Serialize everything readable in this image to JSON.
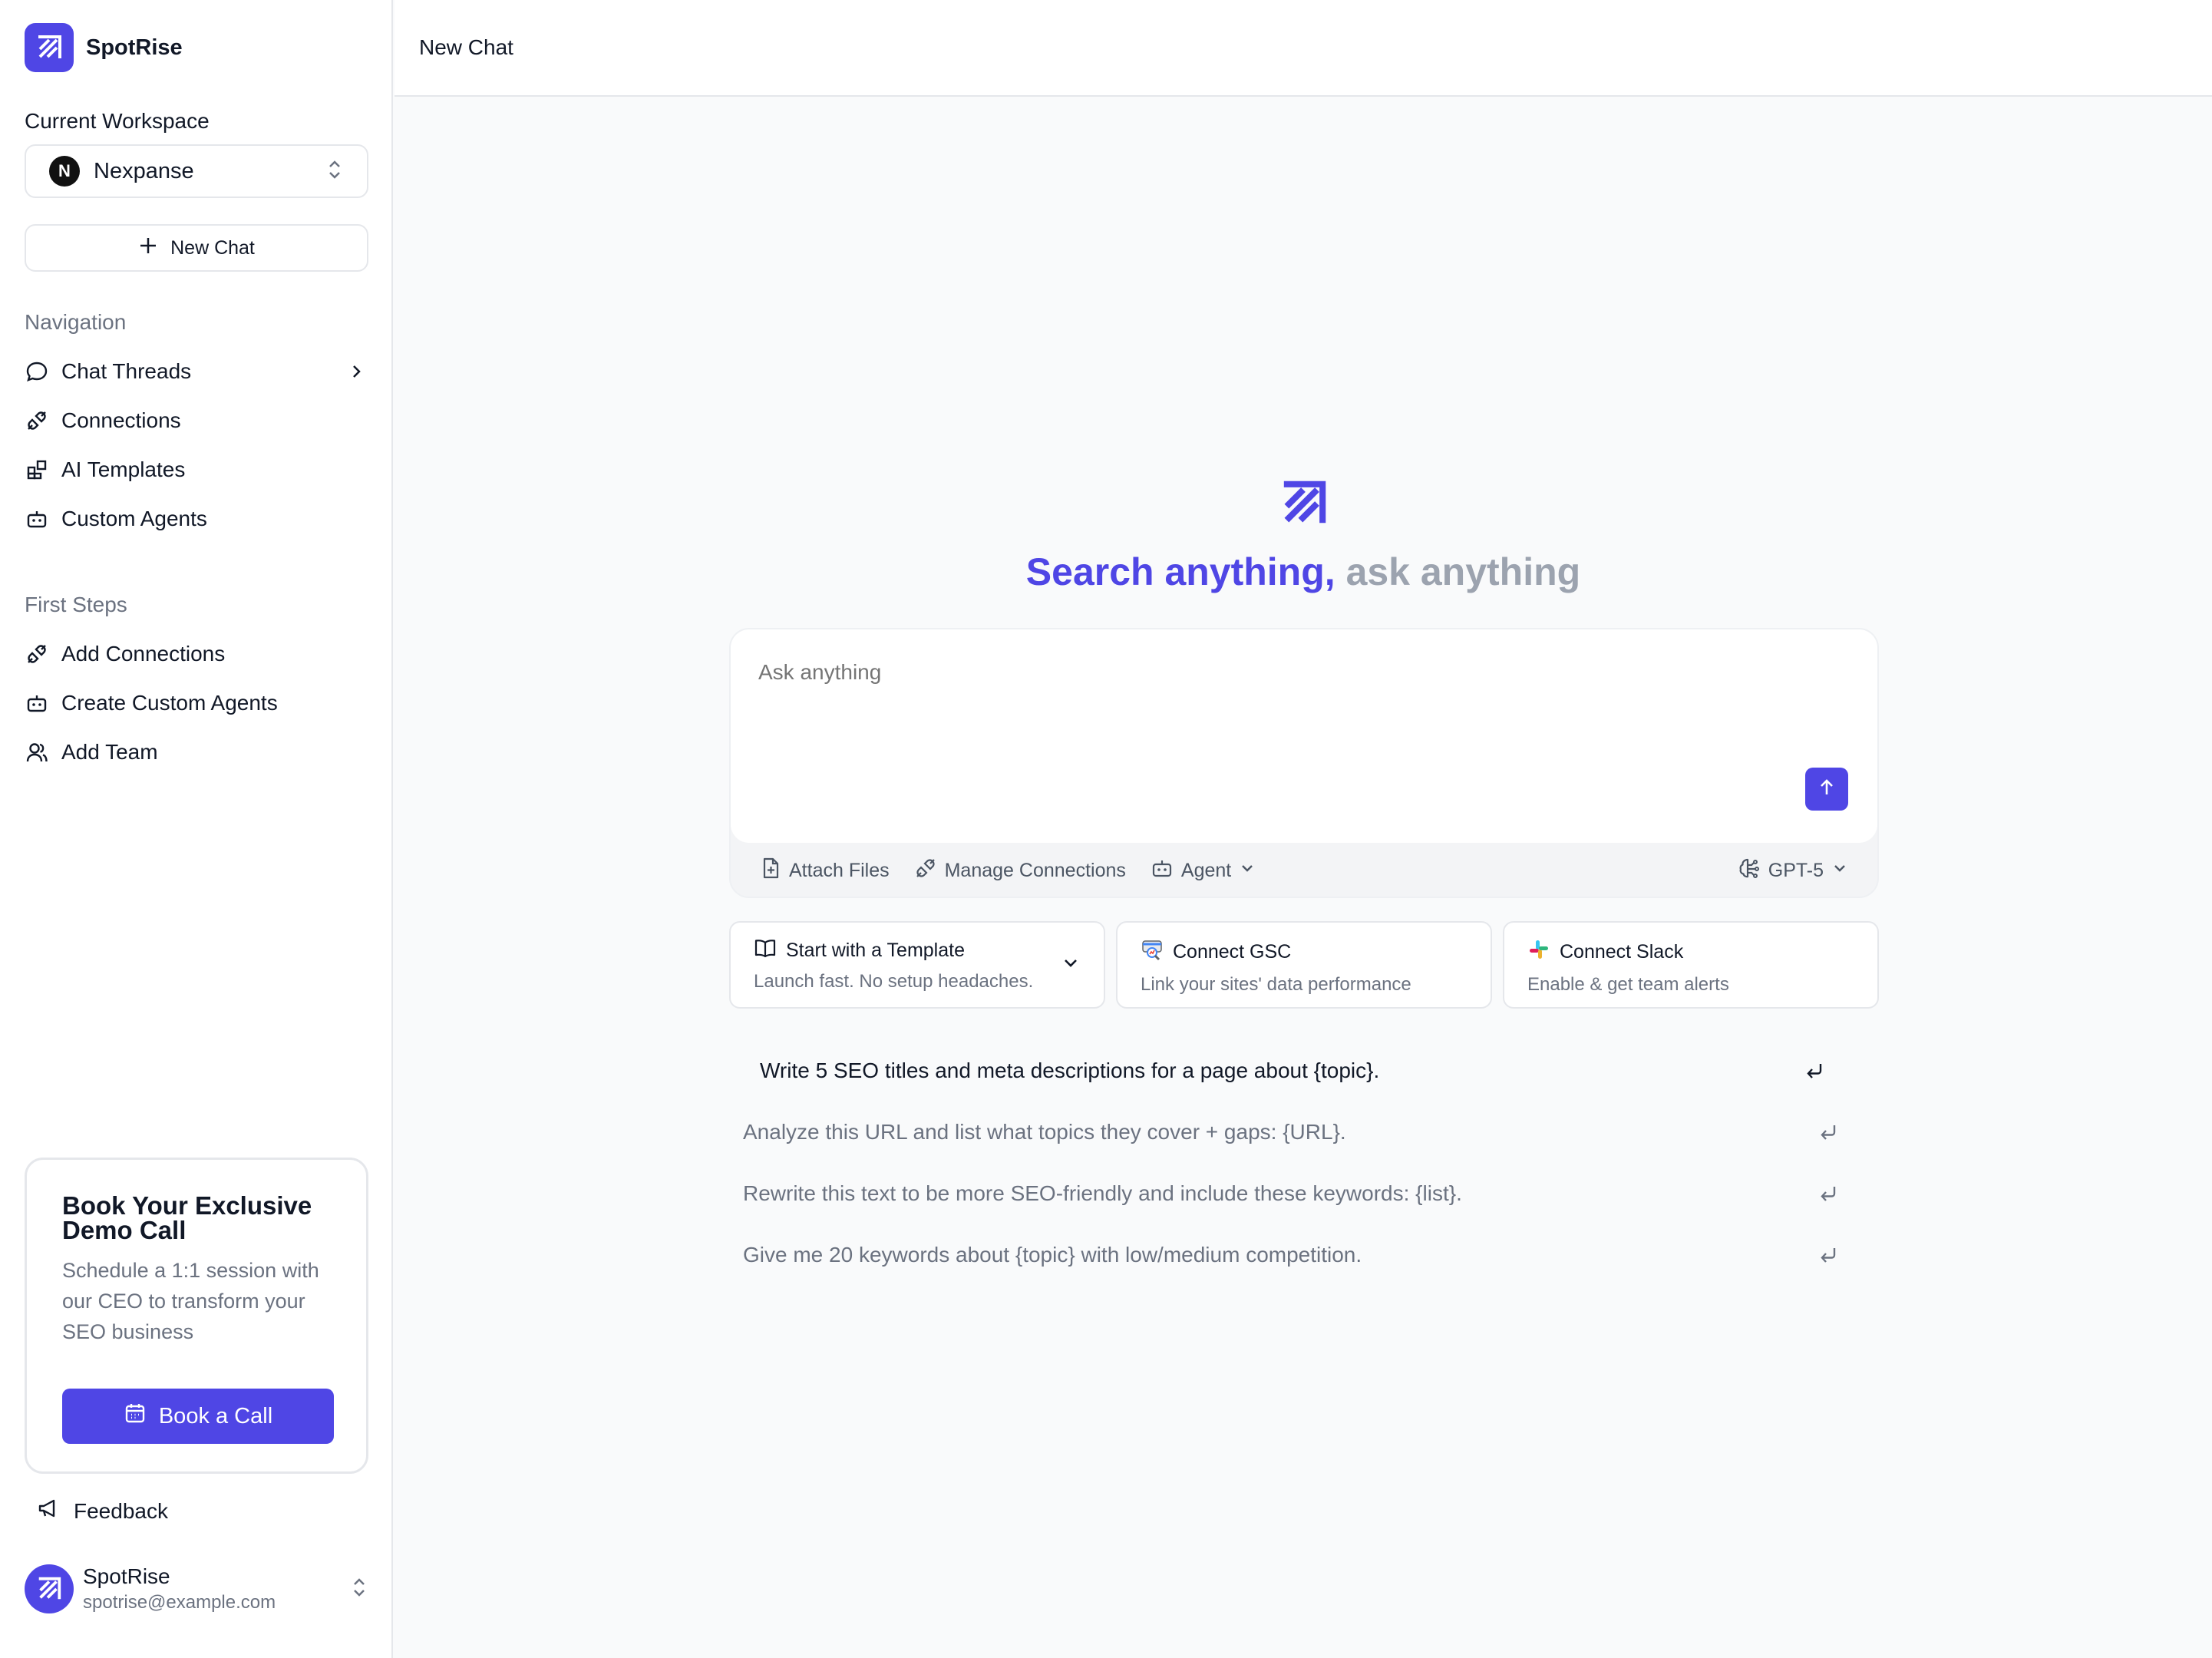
{
  "brand": {
    "name": "SpotRise",
    "accent": "#4f46e5"
  },
  "sidebar": {
    "workspace_label": "Current Workspace",
    "workspace": {
      "initial": "N",
      "name": "Nexpanse"
    },
    "new_chat_label": "New Chat",
    "navigation_label": "Navigation",
    "nav_items": [
      {
        "label": "Chat Threads",
        "icon": "chat-bubble-icon"
      },
      {
        "label": "Connections",
        "icon": "plug-icon"
      },
      {
        "label": "AI Templates",
        "icon": "templates-icon"
      },
      {
        "label": "Custom Agents",
        "icon": "robot-icon"
      }
    ],
    "first_steps_label": "First Steps",
    "first_steps": [
      {
        "label": "Add Connections",
        "icon": "plug-icon"
      },
      {
        "label": "Create Custom Agents",
        "icon": "robot-icon"
      },
      {
        "label": "Add Team",
        "icon": "users-icon"
      }
    ],
    "promo": {
      "title": "Book Your Exclusive Demo Call",
      "description": "Schedule a 1:1 session with our CEO to transform your SEO business",
      "button_label": "Book a Call"
    },
    "feedback_label": "Feedback",
    "user": {
      "name": "SpotRise",
      "email": "spotrise@example.com"
    }
  },
  "topbar": {
    "title": "New Chat"
  },
  "hero": {
    "title_highlight": "Search anything,",
    "title_rest": " ask anything"
  },
  "composer": {
    "placeholder": "Ask anything",
    "tools": {
      "attach": "Attach Files",
      "connections": "Manage Connections",
      "agent": "Agent",
      "model": "GPT-5"
    }
  },
  "cards": [
    {
      "title": "Start with a Template",
      "subtitle": "Launch fast. No setup headaches.",
      "icon": "book-icon"
    },
    {
      "title": "Connect GSC",
      "subtitle": "Link your sites' data performance",
      "icon": "gsc-icon"
    },
    {
      "title": "Connect Slack",
      "subtitle": "Enable & get team alerts",
      "icon": "slack-icon"
    }
  ],
  "prompts": [
    "Write 5 SEO titles and meta descriptions for a page about {topic}.",
    "Analyze this URL and list what topics they cover + gaps: {URL}.",
    "Rewrite this text to be more SEO-friendly and include these keywords: {list}.",
    "Give me 20 keywords about {topic} with low/medium competition."
  ]
}
